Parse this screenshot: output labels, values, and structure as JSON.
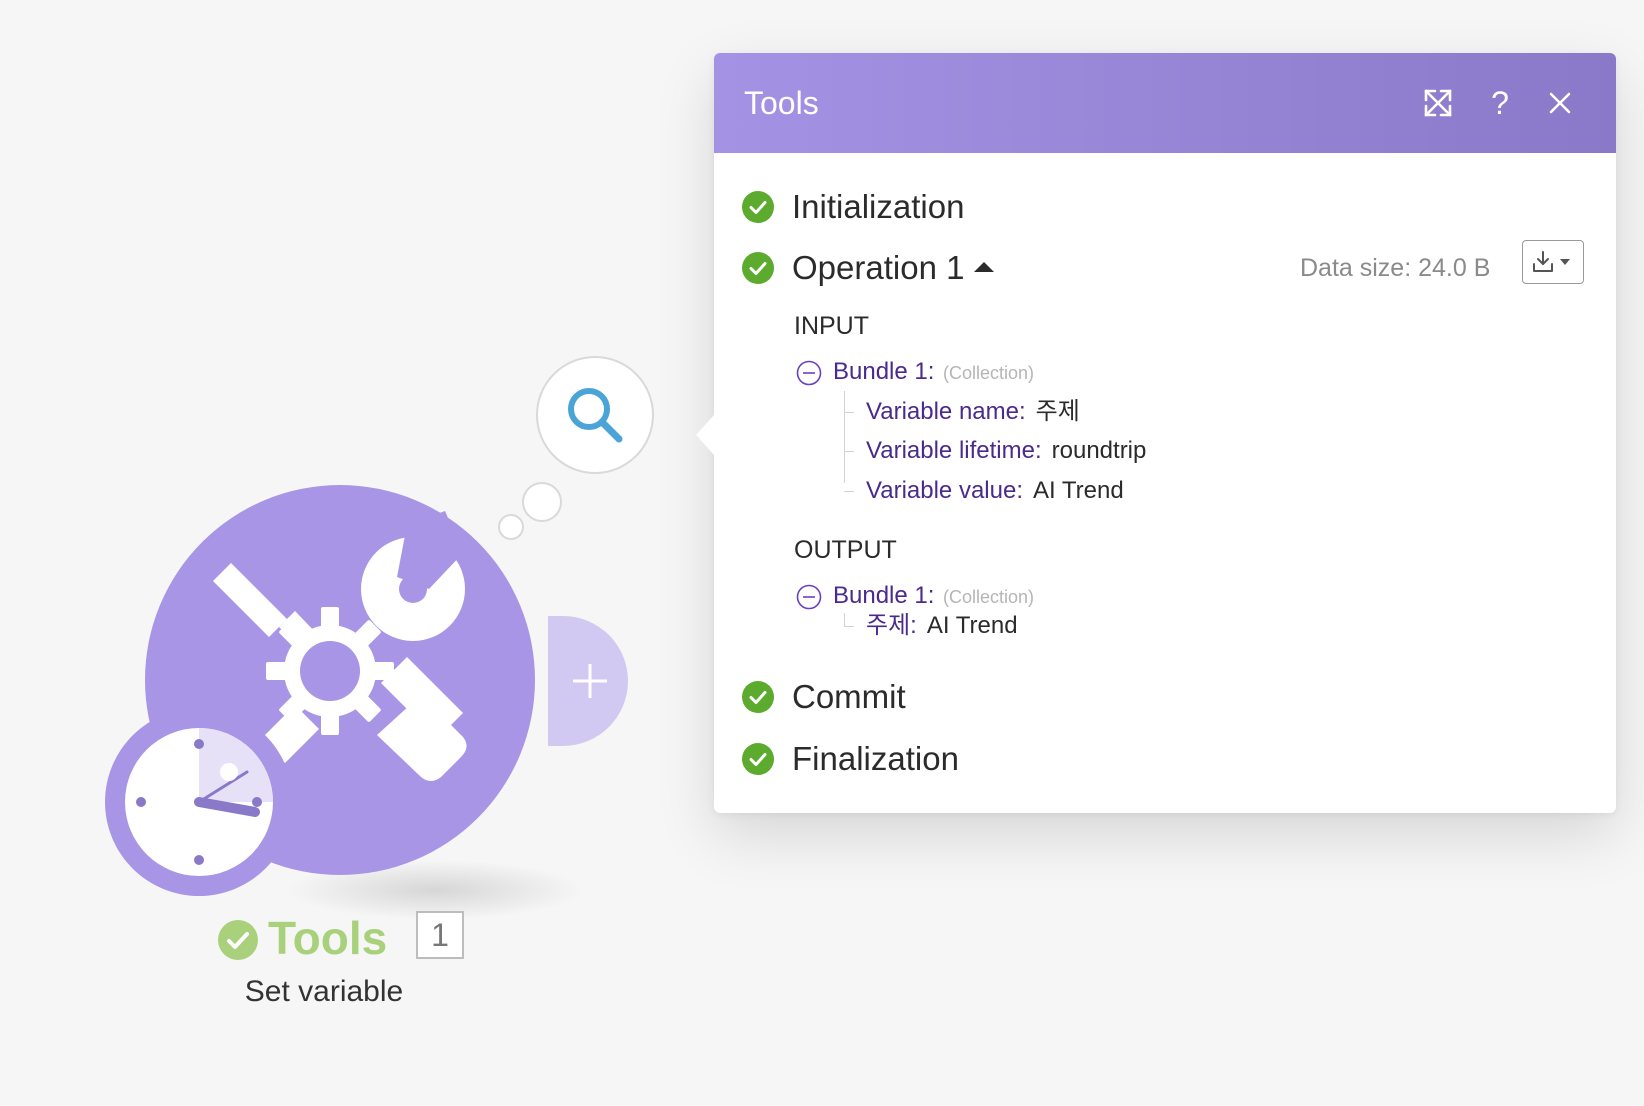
{
  "module": {
    "title": "Tools",
    "run_count": "1",
    "subtitle": "Set variable",
    "colors": {
      "module": "#a895e6",
      "success": "#5cab2e",
      "title_green": "#a9d17b"
    },
    "icons": [
      "tools-icon",
      "clock-icon",
      "search-icon",
      "plus-icon",
      "check-icon"
    ]
  },
  "panel": {
    "title": "Tools",
    "header_gradient": [
      "#a492e4",
      "#8a78c8"
    ],
    "help_label": "?",
    "icons": [
      "expand-icon",
      "help-icon",
      "close-icon",
      "download-icon",
      "caret-down-icon"
    ],
    "phases": {
      "initialization": "Initialization",
      "operation": "Operation 1",
      "commit": "Commit",
      "finalization": "Finalization"
    },
    "data_size": "Data size: 24.0 B",
    "input": {
      "title": "INPUT",
      "bundle_label": "Bundle 1:",
      "bundle_type": "(Collection)",
      "fields": [
        {
          "key": "Variable name:",
          "value": "주제"
        },
        {
          "key": "Variable lifetime:",
          "value": "roundtrip"
        },
        {
          "key": "Variable value:",
          "value": "AI Trend"
        }
      ]
    },
    "output": {
      "title": "OUTPUT",
      "bundle_label": "Bundle 1:",
      "bundle_type": "(Collection)",
      "fields": [
        {
          "key": "주제:",
          "value": "AI Trend"
        }
      ]
    }
  }
}
